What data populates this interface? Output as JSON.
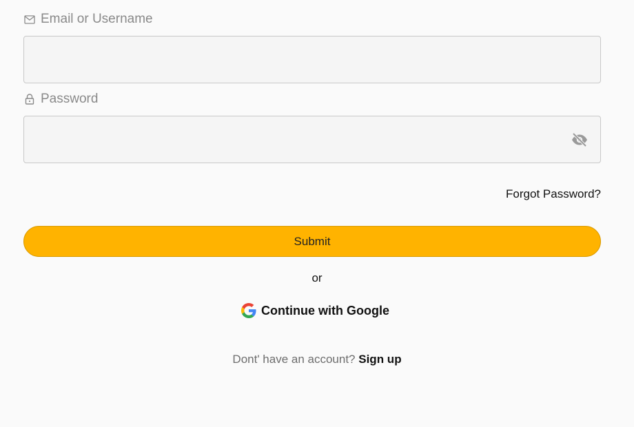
{
  "email": {
    "label": "Email or Username",
    "icon": "mail-icon",
    "value": "",
    "placeholder": ""
  },
  "password": {
    "label": "Password",
    "icon": "lock-icon",
    "value": "",
    "placeholder": "",
    "toggle_icon": "eye-off-icon"
  },
  "forgot_password": "Forgot Password?",
  "submit_label": "Submit",
  "divider_text": "or",
  "google": {
    "label": "Continue with Google",
    "icon": "google-icon"
  },
  "signup": {
    "prompt": "Dont' have an account?",
    "link": "Sign up"
  },
  "colors": {
    "accent": "#ffb300",
    "background": "#fafafa",
    "field_background": "#f5f5f5",
    "label_gray": "#8a8a8a"
  }
}
